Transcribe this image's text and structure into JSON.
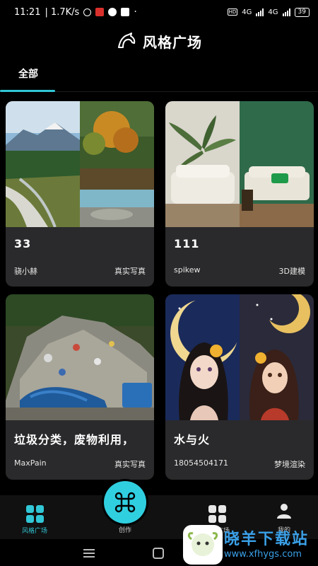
{
  "status_bar": {
    "time": "11:21",
    "speed": "| 1.7K/s",
    "network_left": "4G",
    "network_right": "4G",
    "battery": "39"
  },
  "header": {
    "title": "风格广场"
  },
  "tabs": [
    {
      "label": "全部",
      "active": true
    }
  ],
  "cards": [
    {
      "title": "33",
      "user": "骁小赫",
      "tag": "真实写真"
    },
    {
      "title": "111",
      "user": "spikew",
      "tag": "3D建模"
    },
    {
      "title": "垃圾分类，废物利用，",
      "user": "MaxPain",
      "tag": "真实写真"
    },
    {
      "title": "水与火",
      "user": "18054504171",
      "tag": "梦境渲染"
    }
  ],
  "bottom_nav": {
    "style_square": "风格广场",
    "create": "创作",
    "other_square": "风格广场",
    "mine": "我的"
  },
  "watermark": {
    "title": "晓羊下载站",
    "url": "www.xfhygs.com"
  },
  "colors": {
    "accent": "#31c7d6",
    "card_bg": "#2a2a2c",
    "background": "#000000"
  }
}
